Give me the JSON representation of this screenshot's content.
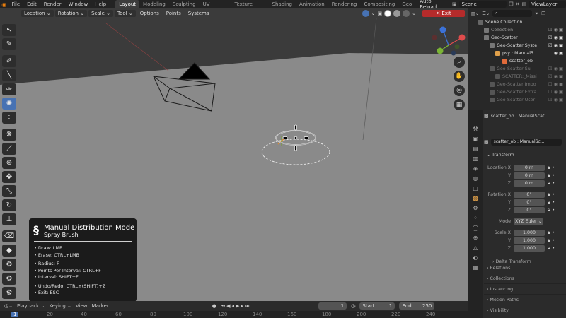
{
  "menu": {
    "items": [
      "File",
      "Edit",
      "Render",
      "Window",
      "Help"
    ],
    "workspaces": [
      "Layout",
      "Modeling",
      "Sculpting",
      "UV Editing",
      "Texture Paint",
      "Shading",
      "Animation",
      "Rendering",
      "Compositing",
      "Geo"
    ],
    "active_workspace": "Layout",
    "auto_reload": "Auto Reload",
    "scene": "Scene",
    "view_layer": "ViewLayer",
    "exit_label": "Exit"
  },
  "viewport_header": {
    "dropdowns": [
      "Location",
      "Rotation",
      "Scale",
      "Tool"
    ],
    "menus": [
      "Options",
      "Points",
      "Systems"
    ]
  },
  "overlay": {
    "title": "Manual Distribution Mode",
    "subtitle": "Spray Brush",
    "group1": [
      "• Draw: LMB",
      "• Erase: CTRL+LMB"
    ],
    "group2": [
      "• Radius: F",
      "• Points Per Interval: CTRL+F",
      "• Interval: SHIFT+F"
    ],
    "group3": [
      "• Undo/Redo: CTRL+(SHIFT)+Z",
      "• Exit: ESC"
    ]
  },
  "timeline": {
    "menus": [
      "Playback",
      "Keying",
      "View",
      "Marker"
    ],
    "current_frame": "1",
    "start_label": "Start",
    "start_value": "1",
    "end_label": "End",
    "end_value": "250",
    "ticks": [
      "1",
      "20",
      "40",
      "60",
      "80",
      "100",
      "120",
      "140",
      "160",
      "180",
      "200",
      "220",
      "240"
    ]
  },
  "outliner": {
    "rows": [
      {
        "label": "Scene Collection",
        "indent": 0
      },
      {
        "label": "Collection",
        "indent": 1
      },
      {
        "label": "Geo-Scatter",
        "indent": 1
      },
      {
        "label": "Geo-Scatter Syste",
        "indent": 2
      },
      {
        "label": "psy : Manual5",
        "indent": 3
      },
      {
        "label": "scatter_ob",
        "indent": 4
      },
      {
        "label": "Geo-Scatter Su",
        "indent": 2
      },
      {
        "label": "SCATTER:_Missi",
        "indent": 3
      },
      {
        "label": "Geo-Scatter Impo",
        "indent": 2
      },
      {
        "label": "Geo-Scatter Extra",
        "indent": 2
      },
      {
        "label": "Geo-Scatter User",
        "indent": 2
      }
    ]
  },
  "properties": {
    "object_name": "scatter_ob : ManualScat..",
    "data_name": "scatter_ob : ManualSc...",
    "transform_title": "Transform",
    "location_label": "Location X",
    "location": [
      "0 m",
      "0 m",
      "0 m"
    ],
    "rotation_label": "Rotation X",
    "rotation": [
      "0°",
      "0°",
      "0°"
    ],
    "mode_label": "Mode",
    "mode_value": "XYZ Euler",
    "scale_label": "Scale X",
    "scale": [
      "1.000",
      "1.000",
      "1.000"
    ],
    "axis_y": "Y",
    "axis_z": "Z",
    "delta_transform": "Delta Transform",
    "sections": [
      "Relations",
      "Collections",
      "Instancing",
      "Motion Paths",
      "Visibility"
    ]
  },
  "colors": {
    "accent": "#4772b3",
    "exit_button": "#b52b2b",
    "blender_orange": "#e87d0d"
  }
}
